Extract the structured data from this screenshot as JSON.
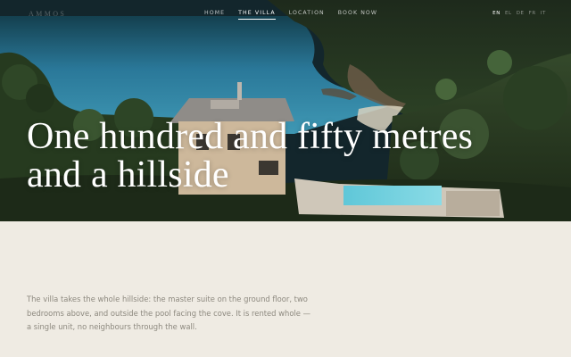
{
  "nav": {
    "brand": "AMMOS",
    "items": [
      {
        "label": "HOME",
        "active": false
      },
      {
        "label": "THE VILLA",
        "active": true
      },
      {
        "label": "LOCATION",
        "active": false
      },
      {
        "label": "BOOK NOW",
        "active": false
      }
    ],
    "languages": [
      {
        "label": "EN",
        "active": true
      },
      {
        "label": "EL",
        "active": false
      },
      {
        "label": "DE",
        "active": false
      },
      {
        "label": "FR",
        "active": false
      },
      {
        "label": "IT",
        "active": false
      }
    ]
  },
  "hero": {
    "headline_line1": "One hundred and fifty metres",
    "headline_line2": "and a hillside"
  },
  "intro": {
    "text": "The villa takes the whole hillside: the master suite on the ground floor, two bedrooms above, and outside the pool facing the cove. It is rented whole — a single unit, no neighbours through the wall."
  },
  "colors": {
    "page_background": "#efebe3",
    "sea": "#2f7fa0",
    "foliage": "#3c5a32",
    "text_muted": "#8d897f"
  }
}
